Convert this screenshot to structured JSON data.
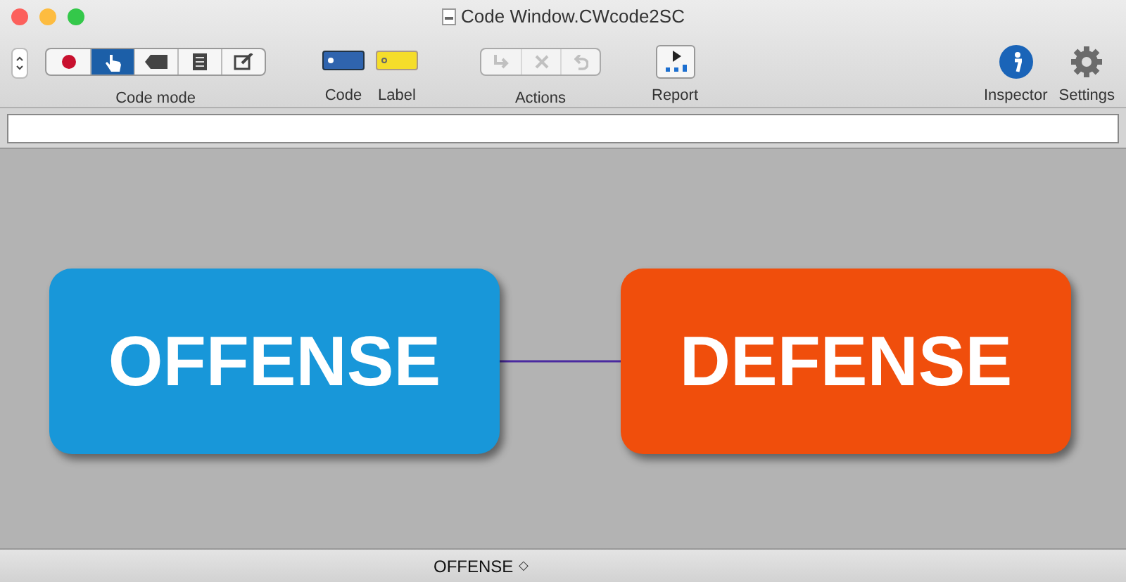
{
  "window": {
    "title": "Code Window.CWcode2SC"
  },
  "toolbar": {
    "code_mode": {
      "label": "Code mode",
      "segments": [
        {
          "kind": "record",
          "selected": false
        },
        {
          "kind": "hand",
          "selected": true
        },
        {
          "kind": "tag",
          "selected": false
        },
        {
          "kind": "document",
          "selected": false
        },
        {
          "kind": "edit",
          "selected": false
        }
      ]
    },
    "code": {
      "label": "Code"
    },
    "label_tool": {
      "label": "Label"
    },
    "actions": {
      "label": "Actions",
      "buttons": [
        {
          "kind": "redirect",
          "disabled": true
        },
        {
          "kind": "delete",
          "disabled": true
        },
        {
          "kind": "undo",
          "disabled": true
        }
      ]
    },
    "report": {
      "label": "Report"
    },
    "inspector": {
      "label": "Inspector"
    },
    "settings": {
      "label": "Settings"
    }
  },
  "canvas": {
    "nodes": [
      {
        "label": "OFFENSE",
        "color": "#1897d9"
      },
      {
        "label": "DEFENSE",
        "color": "#f04e0c"
      }
    ]
  },
  "status_bar": {
    "selection": "OFFENSE",
    "stepper": "◇"
  }
}
